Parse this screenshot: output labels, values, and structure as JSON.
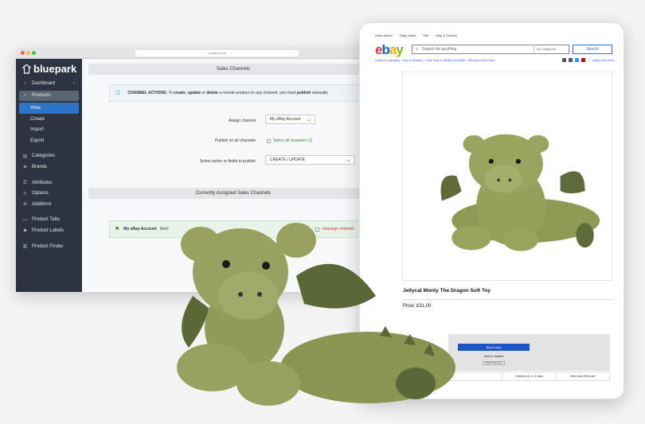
{
  "browser": {
    "url": "mysite.co.uk"
  },
  "sidebar": {
    "brand": "bluepark",
    "dashboard": "Dashboard",
    "products": "Products",
    "sub": [
      "View",
      "Create",
      "Import",
      "Export"
    ],
    "group2": [
      "Categories",
      "Brands"
    ],
    "group3": [
      "Attributes",
      "Options",
      "Additions"
    ],
    "group4": [
      "Product Tabs",
      "Product Labels"
    ],
    "group5": [
      "Product Finder"
    ]
  },
  "sales": {
    "heading": "Sales Channels",
    "actions_label": "CHANNEL ACTIONS:",
    "actions_text_1": " To ",
    "actions_create": "create",
    "actions_text_2": ", ",
    "actions_update": "update",
    "actions_text_3": " or ",
    "actions_delete": "delete",
    "actions_text_4": " a remote product on any channel, you must ",
    "actions_publish": "publish",
    "actions_text_5": " manually",
    "assign_label": "Assign channel",
    "assign_value": "My eBay Account",
    "publish_label": "Publish on all channels",
    "publish_check": "Select all channels (1)",
    "action_label": "Select action or fields to publish",
    "action_value": "CREATE / UPDATE",
    "assigned_heading": "Currently Assigned Sales Channels",
    "assigned_account": "My eBay Account",
    "assigned_tag": "(live)",
    "unassign": "Unassign channel"
  },
  "ebay": {
    "topnav": [
      "Hello Jane ▾",
      "Daily Deals",
      "Sell",
      "Help & Contact"
    ],
    "logo_letters": [
      "e",
      "b",
      "a",
      "y"
    ],
    "search_placeholder": "Search for anything",
    "category": "All Categories",
    "search_button": "Search",
    "breadcrumb": "Listed in category:  Toys & Games  >  Soft Toys & Stuffed Animals  >  Branded Soft Toys",
    "watch": "Watch this item",
    "title": "Jellycat Monty The Dragon Soft Toy",
    "price": "Price: £31.00",
    "buy_now": "Buy it now",
    "add_basket": "Add to basket",
    "add_watch": "Watch this item",
    "info": [
      "",
      "Delivery est. in 3 days",
      "More than 60% sold"
    ]
  },
  "colors": {
    "sidebar_bg": "#2b3440",
    "accent_blue": "#2d74c7",
    "ebay_e": "#e53238",
    "ebay_b": "#0064d2",
    "ebay_a": "#f5af02",
    "ebay_y": "#86b817",
    "dragon_green": "#8f9a55"
  }
}
